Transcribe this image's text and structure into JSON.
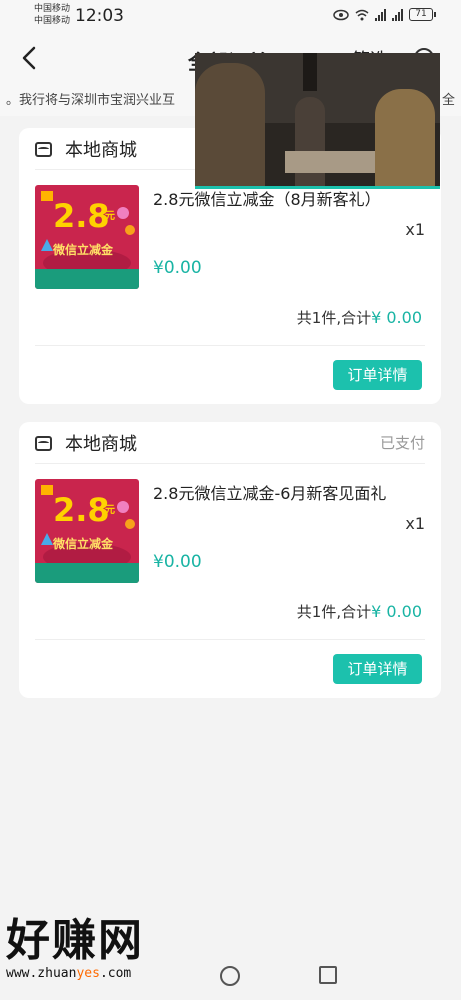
{
  "status_bar": {
    "carrier_1": "中国移动",
    "carrier_2": "中国移动",
    "time": "12:03",
    "battery": "71"
  },
  "nav": {
    "title": "全部订单",
    "filter_label": "筛选"
  },
  "notice": {
    "text": "。我行将与深圳市宝润兴业互",
    "tail": "全"
  },
  "orders": [
    {
      "shop": "本地商城",
      "status": "",
      "product_name": "2.8元微信立减金（8月新客礼）",
      "quantity": "x1",
      "price": "¥0.00",
      "summary_label": "共1件,合计",
      "summary_value": "¥ 0.00",
      "detail_button": "订单详情",
      "thumb_big": "2.8",
      "thumb_unit": "元",
      "thumb_text": "微信立减金"
    },
    {
      "shop": "本地商城",
      "status": "已支付",
      "product_name": "2.8元微信立减金-6月新客见面礼",
      "quantity": "x1",
      "price": "¥0.00",
      "summary_label": "共1件,合计",
      "summary_value": "¥ 0.00",
      "detail_button": "订单详情",
      "thumb_big": "2.8",
      "thumb_unit": "元",
      "thumb_text": "微信立减金"
    }
  ],
  "watermark": {
    "main": "好赚网",
    "url_pre": "www.zhuan",
    "url_hl": "yes",
    "url_post": ".com"
  },
  "colors": {
    "accent": "#1cc1ad",
    "price": "#19b4a4"
  }
}
